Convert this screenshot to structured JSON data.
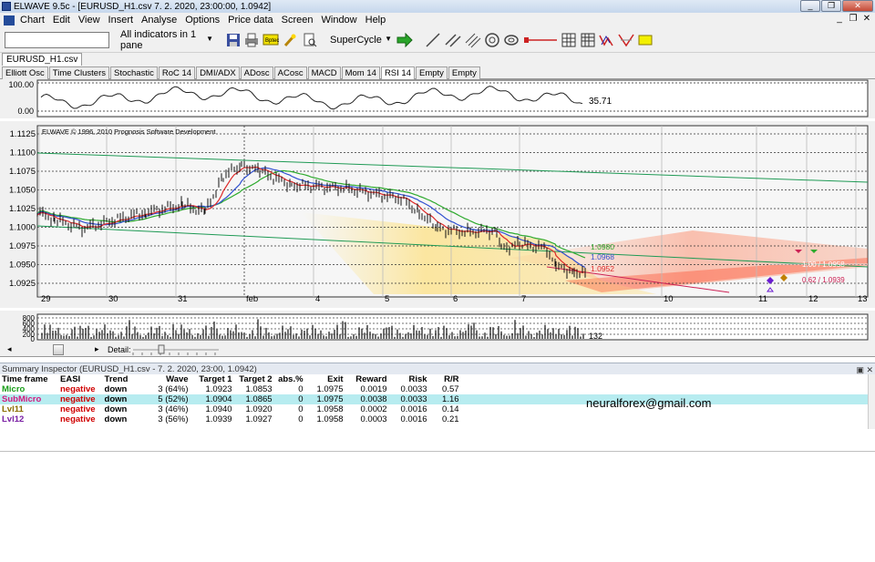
{
  "window": {
    "title": "ELWAVE 9.5c - [EURUSD_H1.csv  7. 2. 2020, 23:00:00, 1.0942]"
  },
  "window_buttons": [
    "_",
    "❐",
    "✕"
  ],
  "menu": [
    "Chart",
    "Edit",
    "View",
    "Insert",
    "Analyse",
    "Options",
    "Price data",
    "Screen",
    "Window",
    "Help"
  ],
  "mdi_buttons": [
    "_",
    "❐",
    "✕"
  ],
  "toolbar": {
    "input_value": "",
    "indicators_select": "All indicators in 1 pane",
    "supercycle_select": "SuperCycle"
  },
  "file_tab": "EURUSD_H1.csv",
  "indicator_tabs": [
    "Elliott Osc",
    "Time Clusters",
    "Stochastic",
    "RoC 14",
    "DMI/ADX",
    "ADosc",
    "ACosc",
    "MACD",
    "Mom 14",
    "RSI 14",
    "Empty",
    "Empty"
  ],
  "active_indicator_tab": "RSI 14",
  "rsi_pane": {
    "y_labels": [
      "100.00",
      "0.00"
    ],
    "last_value": "35.71"
  },
  "price_pane": {
    "copyright": "ELWAVE © 1996, 2010 Prognosis Software Development",
    "y_labels": [
      "1.1125",
      "1.1100",
      "1.1075",
      "1.1050",
      "1.1025",
      "1.1000",
      "1.0975",
      "1.0950",
      "1.0925"
    ],
    "x_labels": [
      "29",
      "30",
      "31",
      "feb",
      "4",
      "5",
      "6",
      "7",
      "10",
      "11",
      "12",
      "13"
    ],
    "level_labels": [
      "1.0980",
      "1.0968",
      "1.0952",
      "1.00 / 1.0958",
      "0.62 / 1.0939"
    ]
  },
  "volume_pane": {
    "y_labels": [
      "800",
      "600",
      "400",
      "200",
      "0"
    ],
    "last_value": "132"
  },
  "scroll": {
    "detail_label": "Detail:"
  },
  "summary": {
    "header": "Summary Inspector (EURUSD_H1.csv - 7. 2. 2020, 23:00, 1.0942)",
    "header_controls": "▣ ✕",
    "columns": [
      "Time frame",
      "EASI",
      "Trend",
      "Wave",
      "Target 1",
      "Target 2",
      "abs.%",
      "Exit",
      "Reward",
      "Risk",
      "R/R"
    ],
    "rows": [
      {
        "tf": "Micro",
        "tf_color": "#1a9e1a",
        "easi": "negative",
        "trend": "down",
        "wave": "3 (64%)",
        "t1": "1.0923",
        "t2": "1.0853",
        "abs": "0",
        "exit": "1.0975",
        "reward": "0.0019",
        "risk": "0.0033",
        "rr": "0.57",
        "hl": false
      },
      {
        "tf": "SubMicro",
        "tf_color": "#d2197f",
        "easi": "negative",
        "trend": "down",
        "wave": "5 (52%)",
        "t1": "1.0904",
        "t2": "1.0865",
        "abs": "0",
        "exit": "1.0975",
        "reward": "0.0038",
        "risk": "0.0033",
        "rr": "1.16",
        "hl": true
      },
      {
        "tf": "Lvl11",
        "tf_color": "#8a6d00",
        "easi": "negative",
        "trend": "down",
        "wave": "3 (46%)",
        "t1": "1.0940",
        "t2": "1.0920",
        "abs": "0",
        "exit": "1.0958",
        "reward": "0.0002",
        "risk": "0.0016",
        "rr": "0.14",
        "hl": false
      },
      {
        "tf": "Lvl12",
        "tf_color": "#7a1fa3",
        "easi": "negative",
        "trend": "down",
        "wave": "3 (56%)",
        "t1": "1.0939",
        "t2": "1.0927",
        "abs": "0",
        "exit": "1.0958",
        "reward": "0.0003",
        "risk": "0.0016",
        "rr": "0.21",
        "hl": false
      }
    ],
    "easi_color": "#d00000"
  },
  "email": "neuralforex@gmail.com",
  "colors": {
    "accent": "#2a4d9b",
    "grid": "#333333",
    "bull": "#1e8c1e",
    "bear": "#cc2222"
  }
}
